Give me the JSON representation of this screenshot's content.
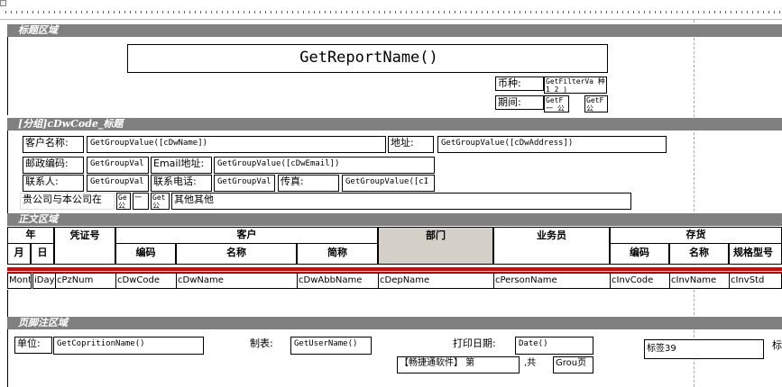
{
  "bands": {
    "title": "标题区域",
    "group": "[分组]cDwCode_标题",
    "body": "正文区域",
    "footer": "页脚注区域"
  },
  "title_area": {
    "report_name": "GetReportName()",
    "currency_label": "币种:",
    "currency_value": "GetFilterVa 种1 2 )",
    "period_label": "期间:",
    "period_value1": "GetF 一 公",
    "period_value2": "GetF 公"
  },
  "group_area": {
    "customer_name_label": "客户名称:",
    "customer_name_value": "GetGroupValue([cDwName])",
    "address_label": "地址:",
    "address_value": "GetGroupValue([cDwAddress])",
    "postcode_label": "邮政编码:",
    "postcode_value": "GetGroupVal",
    "email_label": "Email地址:",
    "email_value": "GetGroupValue([cDwEmail])",
    "contact_label": "联系人:",
    "contact_value": "GetGroupVal",
    "phone_label": "联系电话:",
    "phone_value": "GetGroupVal",
    "fax_label": "传真:",
    "fax_value": "GetGroupValue([cI",
    "statement_label": "贵公司与本公司在",
    "statement_v1": "Ge 公",
    "statement_v2": "一",
    "statement_v3": "Get 公",
    "other_label": "其他其他"
  },
  "table_header": {
    "year": "年",
    "month": "月",
    "day": "日",
    "voucher_no": "凭证号",
    "customer": "客户",
    "code": "编码",
    "name": "名称",
    "abbr": "简称",
    "department": "部门",
    "salesperson": "业务员",
    "inventory": "存货",
    "inv_code": "编码",
    "inv_name": "名称",
    "inv_spec": "规格型号"
  },
  "table_row": {
    "month": "Month",
    "day": "iDay",
    "voucher": "cPzNum",
    "dw_code": "cDwCode",
    "dw_name": "cDwName",
    "dw_abbr": "cDwAbbName",
    "dep_name": "cDepName",
    "person_name": "cPersonName",
    "inv_code": "cInvCode",
    "inv_name": "cInvName",
    "inv_std": "cInvStd"
  },
  "footer_area": {
    "unit_label": "单位:",
    "unit_value": "GetCopritionName()",
    "maker_label": "制表:",
    "maker_value": "GetUserName()",
    "print_date_label": "打印日期:",
    "print_date_value": "Date()",
    "label39": "标签39",
    "label_partial": "标",
    "software": "【畅捷通软件】 第",
    "page_sep": ",共",
    "page_total": "Grou页"
  }
}
